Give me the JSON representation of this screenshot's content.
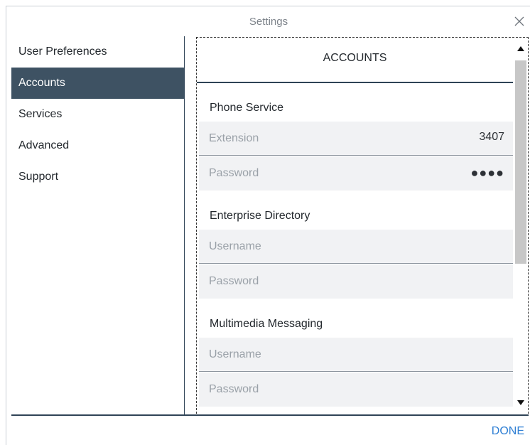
{
  "window": {
    "title": "Settings"
  },
  "sidebar": {
    "items": [
      {
        "label": "User Preferences"
      },
      {
        "label": "Accounts"
      },
      {
        "label": "Services"
      },
      {
        "label": "Advanced"
      },
      {
        "label": "Support"
      }
    ],
    "selected": "Accounts"
  },
  "content": {
    "header": "ACCOUNTS",
    "phone_service": {
      "title": "Phone Service",
      "extension_label": "Extension",
      "extension_value": "3407",
      "password_label": "Password",
      "password_value": "●●●●"
    },
    "enterprise_directory": {
      "title": "Enterprise Directory",
      "username_label": "Username",
      "password_label": "Password"
    },
    "multimedia_messaging": {
      "title": "Multimedia Messaging",
      "username_label": "Username",
      "password_label": "Password"
    }
  },
  "footer": {
    "done_label": "DONE"
  },
  "colors": {
    "accent": "#2f7fd4",
    "selected_bg": "#3e5263",
    "field_bg": "#f1f2f4",
    "divider": "#2f4356"
  },
  "icons": {
    "close": "close-icon",
    "scroll_up": "scroll-up-arrow-icon",
    "scroll_down": "scroll-down-arrow-icon"
  }
}
